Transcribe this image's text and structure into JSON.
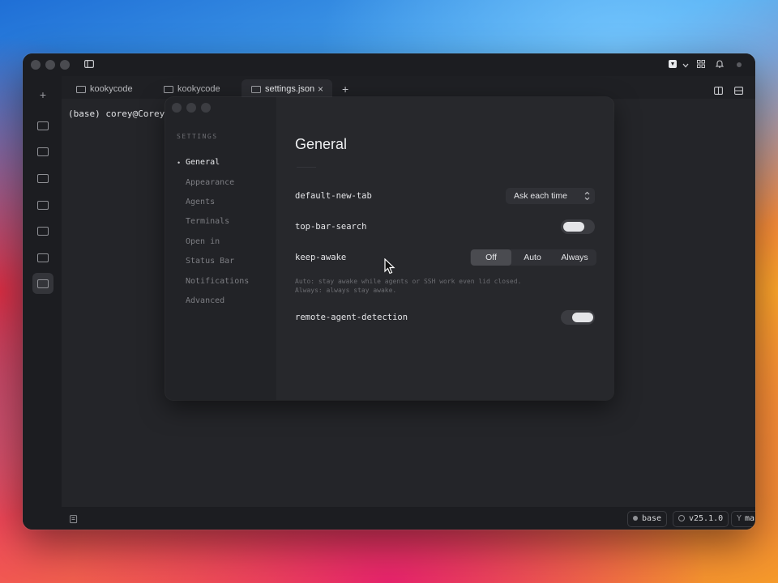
{
  "tabs": [
    {
      "label": "kookycode",
      "active": false
    },
    {
      "label": "kookycode",
      "active": false
    },
    {
      "label": "settings.json",
      "active": true
    }
  ],
  "tab_close_icon": "×",
  "new_tab_icon": "+",
  "rail_add_icon": "+",
  "terminal": {
    "prompt": "(base) corey@Corey"
  },
  "settings": {
    "sidebar_title": "SETTINGS",
    "nav": [
      {
        "label": "General",
        "active": true
      },
      {
        "label": "Appearance",
        "active": false
      },
      {
        "label": "Agents",
        "active": false
      },
      {
        "label": "Terminals",
        "active": false
      },
      {
        "label": "Open in",
        "active": false
      },
      {
        "label": "Status Bar",
        "active": false
      },
      {
        "label": "Notifications",
        "active": false
      },
      {
        "label": "Advanced",
        "active": false
      }
    ],
    "nav_active_marker": "•",
    "heading": "General",
    "rows": {
      "default_new_tab": {
        "label": "default-new-tab",
        "value": "Ask each time",
        "chevron": "⌃⌄"
      },
      "top_bar_search": {
        "label": "top-bar-search",
        "enabled": true
      },
      "keep_awake": {
        "label": "keep-awake",
        "options": [
          "Off",
          "Auto",
          "Always"
        ],
        "selected": "Off",
        "hint_1": "Auto: stay awake while agents or SSH work even lid closed.",
        "hint_2": "Always: always stay awake."
      },
      "remote_agent_detection": {
        "label": "remote-agent-detection",
        "enabled": true
      }
    }
  },
  "statusbar": {
    "env": "base",
    "version": "v25.1.0",
    "branch": "main"
  },
  "icons": {
    "sidebar_toggle": "sidebar-icon",
    "settings_glyph": "terminal-icon",
    "notifications": "bell-icon"
  }
}
